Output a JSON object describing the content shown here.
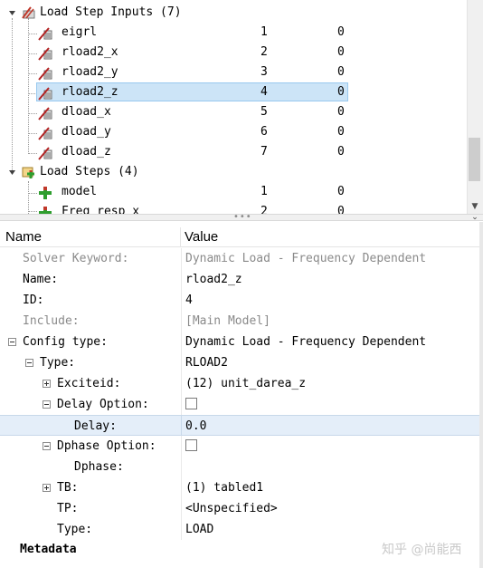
{
  "tree": {
    "rows": [
      {
        "label": "Load Step Inputs (7)",
        "col1": "",
        "col2": "",
        "icon": "load-step-inputs-icon",
        "kind": "folder"
      },
      {
        "label": "eigrl",
        "col1": "1",
        "col2": "0",
        "icon": "load-input-icon"
      },
      {
        "label": "rload2_x",
        "col1": "2",
        "col2": "0",
        "icon": "load-input-icon"
      },
      {
        "label": "rload2_y",
        "col1": "3",
        "col2": "0",
        "icon": "load-input-icon"
      },
      {
        "label": "rload2_z",
        "col1": "4",
        "col2": "0",
        "icon": "load-input-icon",
        "selected": true
      },
      {
        "label": "dload_x",
        "col1": "5",
        "col2": "0",
        "icon": "load-input-icon"
      },
      {
        "label": "dload_y",
        "col1": "6",
        "col2": "0",
        "icon": "load-input-icon"
      },
      {
        "label": "dload_z",
        "col1": "7",
        "col2": "0",
        "icon": "load-input-icon"
      },
      {
        "label": "Load Steps (4)",
        "col1": "",
        "col2": "",
        "icon": "load-steps-icon",
        "kind": "folder"
      },
      {
        "label": "model",
        "col1": "1",
        "col2": "0",
        "icon": "load-step-icon"
      },
      {
        "label": "Freq_resp_x",
        "col1": "2",
        "col2": "0",
        "icon": "load-step-icon"
      }
    ]
  },
  "grid": {
    "header_name": "Name",
    "header_value": "Value",
    "rows": [
      {
        "key": "Solver Keyword:",
        "value": "Dynamic Load - Frequency Dependent",
        "grey": true
      },
      {
        "key": "Name:",
        "value": "rload2_z"
      },
      {
        "key": "ID:",
        "value": "4"
      },
      {
        "key": "Include:",
        "value": "[Main Model]",
        "grey": true
      },
      {
        "key": "Config type:",
        "value": "Dynamic Load - Frequency Dependent"
      },
      {
        "key": "Type:",
        "value": "RLOAD2"
      },
      {
        "key": "Exciteid:",
        "value": "(12) unit_darea_z"
      },
      {
        "key": "Delay Option:",
        "value": ""
      },
      {
        "key": "Delay:",
        "value": "0.0"
      },
      {
        "key": "Dphase Option:",
        "value": ""
      },
      {
        "key": "Dphase:",
        "value": ""
      },
      {
        "key": "TB:",
        "value": "(1) tabled1"
      },
      {
        "key": "TP:",
        "value": "<Unspecified>"
      },
      {
        "key": "Type:",
        "value": "LOAD"
      }
    ],
    "delay_option_checked": false,
    "dphase_option_checked": false,
    "metadata_label": "Metadata"
  },
  "watermark": "知乎 @尚能西"
}
